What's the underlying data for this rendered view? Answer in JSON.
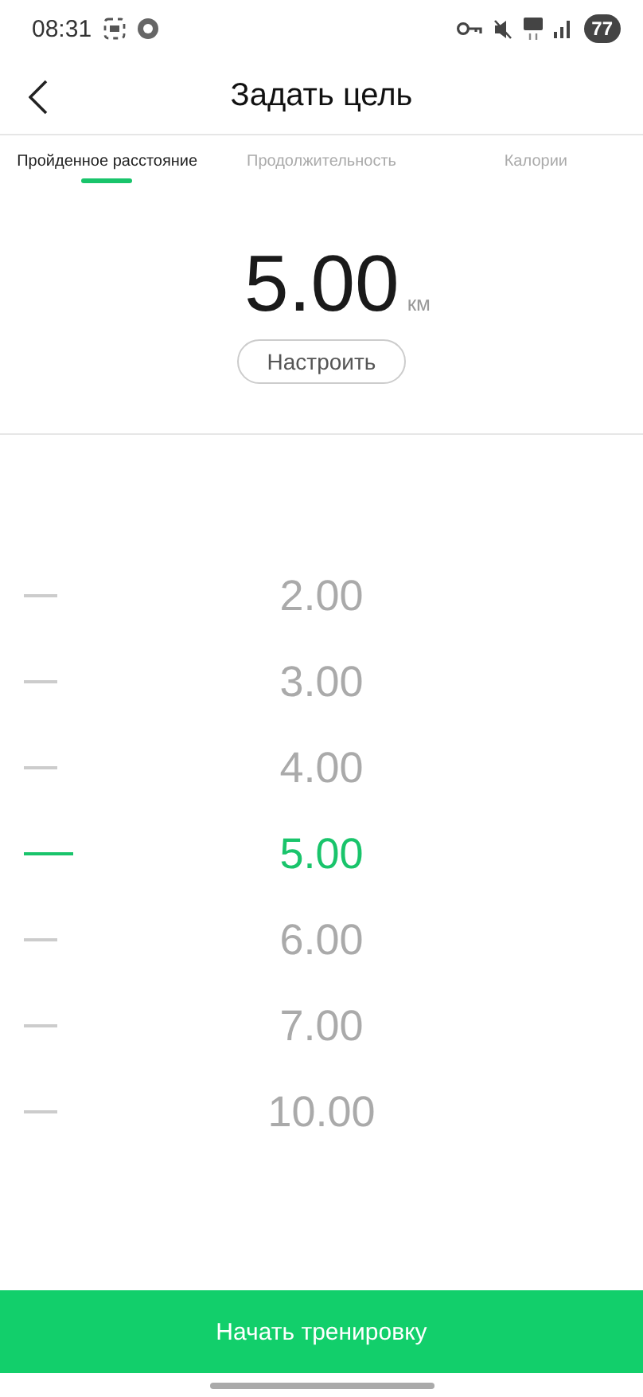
{
  "status_bar": {
    "time": "08:31",
    "battery": "77"
  },
  "header": {
    "title": "Задать цель"
  },
  "tabs": [
    {
      "label": "Пройденное расстояние",
      "selected": true
    },
    {
      "label": "Продолжительность",
      "selected": false
    },
    {
      "label": "Калории",
      "selected": false
    }
  ],
  "goal": {
    "value": "5.00",
    "unit": "км",
    "adjust_button": "Настроить"
  },
  "picker": [
    {
      "value": "2.00",
      "selected": false
    },
    {
      "value": "3.00",
      "selected": false
    },
    {
      "value": "4.00",
      "selected": false
    },
    {
      "value": "5.00",
      "selected": true
    },
    {
      "value": "6.00",
      "selected": false
    },
    {
      "value": "7.00",
      "selected": false
    },
    {
      "value": "10.00",
      "selected": false
    }
  ],
  "start_button": "Начать тренировку"
}
